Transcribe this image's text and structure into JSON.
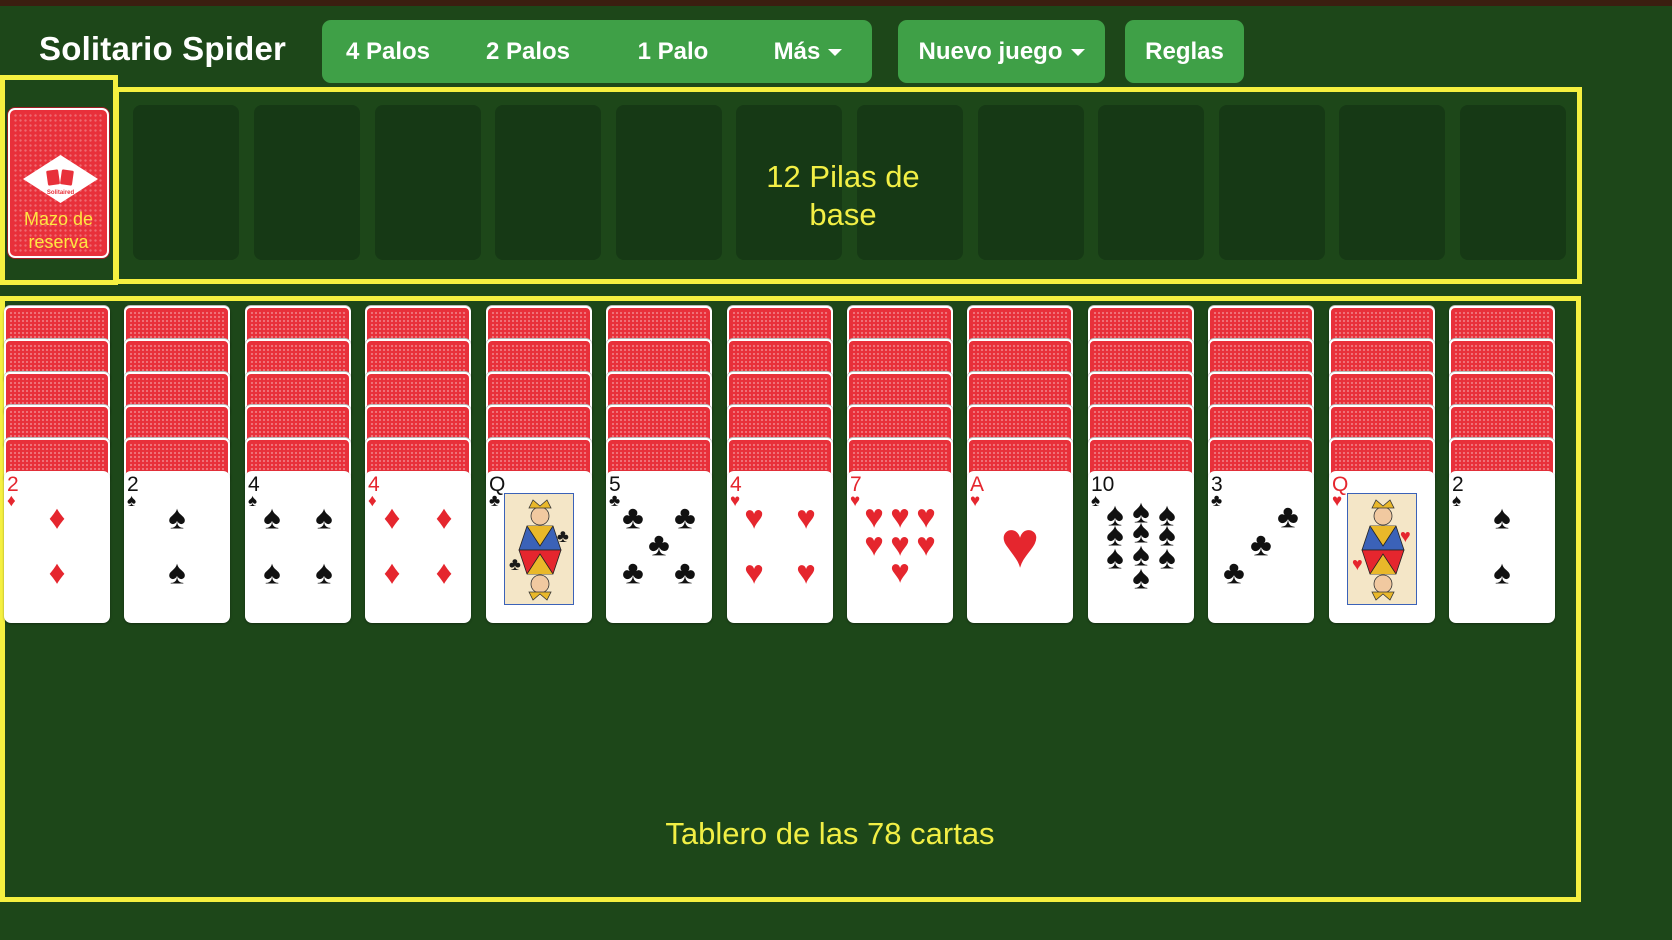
{
  "app": {
    "title": "Solitario Spider"
  },
  "nav": {
    "suit_buttons": [
      {
        "label": "4 Palos"
      },
      {
        "label": "2 Palos"
      },
      {
        "label": "1 Palo"
      },
      {
        "label": "Más",
        "dropdown": true
      }
    ],
    "new_game": {
      "label": "Nuevo juego",
      "dropdown": true
    },
    "rules": {
      "label": "Reglas"
    }
  },
  "stock": {
    "label": "Mazo de reserva",
    "logo_text": "Solitaired"
  },
  "annotations": {
    "foundations": "12 Pilas de base",
    "tableau": "Tablero de las 78 cartas"
  },
  "foundations": {
    "count": 12
  },
  "tableau": {
    "face_down_per_column": 5,
    "columns": [
      {
        "rank": "2",
        "suit": "♦",
        "color": "red"
      },
      {
        "rank": "2",
        "suit": "♠",
        "color": "black"
      },
      {
        "rank": "4",
        "suit": "♠",
        "color": "black"
      },
      {
        "rank": "4",
        "suit": "♦",
        "color": "red"
      },
      {
        "rank": "Q",
        "suit": "♣",
        "color": "black"
      },
      {
        "rank": "5",
        "suit": "♣",
        "color": "black"
      },
      {
        "rank": "4",
        "suit": "♥",
        "color": "red"
      },
      {
        "rank": "7",
        "suit": "♥",
        "color": "red"
      },
      {
        "rank": "A",
        "suit": "♥",
        "color": "red"
      },
      {
        "rank": "10",
        "suit": "♠",
        "color": "black"
      },
      {
        "rank": "3",
        "suit": "♣",
        "color": "black"
      },
      {
        "rank": "Q",
        "suit": "♥",
        "color": "red"
      },
      {
        "rank": "2",
        "suit": "♠",
        "color": "black"
      }
    ]
  },
  "colors": {
    "table": "#1d4719",
    "button": "#3fa047",
    "highlight": "#f5f040",
    "card_back": "#e8303a",
    "red_suit": "#e5262e"
  }
}
